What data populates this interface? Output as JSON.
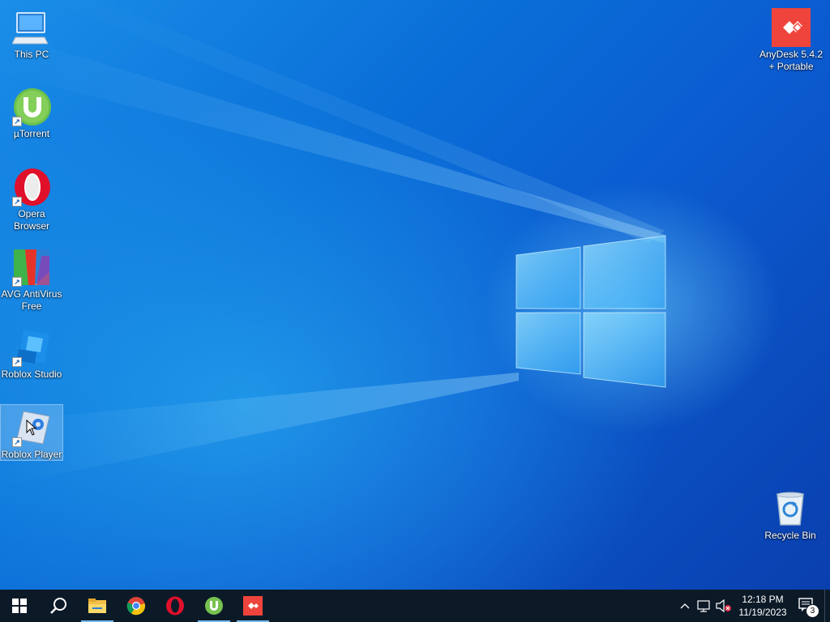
{
  "desktop": {
    "icons_left": [
      {
        "label": "This PC",
        "icon": "this-pc-icon"
      },
      {
        "label": "µTorrent",
        "icon": "utorrent-icon"
      },
      {
        "label": "Opera Browser",
        "icon": "opera-icon"
      },
      {
        "label": "AVG AntiVirus Free",
        "icon": "avg-icon"
      },
      {
        "label": "Roblox Studio",
        "icon": "roblox-studio-icon"
      },
      {
        "label": "Roblox Player",
        "icon": "roblox-player-icon"
      }
    ],
    "anydesk_label": "AnyDesk 5.4.2 + Portable",
    "recycle_bin_label": "Recycle Bin"
  },
  "taskbar": {
    "pinned": [
      "windows-start-icon",
      "search-icon",
      "file-explorer-icon",
      "chrome-icon",
      "opera-icon",
      "utorrent-icon",
      "anydesk-icon"
    ],
    "clock_time": "12:18 PM",
    "clock_date": "11/19/2023",
    "notification_count": "3"
  },
  "colors": {
    "taskbar_bg": "#0c1a28",
    "accent": "#76b9ed",
    "anydesk_red": "#ef443b"
  }
}
